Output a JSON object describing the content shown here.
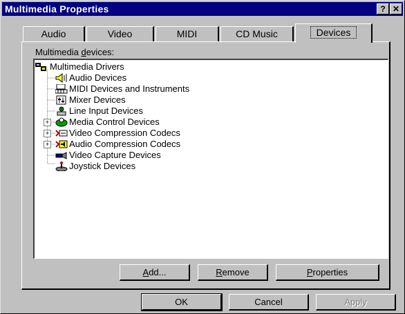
{
  "window": {
    "title": "Multimedia Properties",
    "help_label": "?",
    "close_label": "✕"
  },
  "tabs": [
    {
      "label": "Audio",
      "active": false
    },
    {
      "label": "Video",
      "active": false
    },
    {
      "label": "MIDI",
      "active": false
    },
    {
      "label": "CD Music",
      "active": false
    },
    {
      "label": "Devices",
      "active": true
    }
  ],
  "devices_panel": {
    "group_label_pre": "Multimedia ",
    "group_label_accel": "d",
    "group_label_post": "evices:",
    "tree": {
      "root": {
        "label": "Multimedia Drivers",
        "icon": "multimedia-drivers-icon"
      },
      "items": [
        {
          "label": "Audio Devices",
          "icon": "speaker-icon",
          "expandable": false
        },
        {
          "label": "MIDI Devices and Instruments",
          "icon": "midi-keyboard-icon",
          "expandable": false
        },
        {
          "label": "Mixer Devices",
          "icon": "mixer-icon",
          "expandable": false
        },
        {
          "label": "Line Input Devices",
          "icon": "line-input-icon",
          "expandable": false
        },
        {
          "label": "Media Control Devices",
          "icon": "media-control-icon",
          "expandable": true
        },
        {
          "label": "Video Compression Codecs",
          "icon": "video-codec-icon",
          "expandable": true
        },
        {
          "label": "Audio Compression Codecs",
          "icon": "audio-codec-icon",
          "expandable": true
        },
        {
          "label": "Video Capture Devices",
          "icon": "video-capture-icon",
          "expandable": false
        },
        {
          "label": "Joystick Devices",
          "icon": "joystick-icon",
          "expandable": false
        }
      ]
    },
    "buttons": {
      "add": {
        "pre": "",
        "accel": "A",
        "post": "dd..."
      },
      "remove": {
        "pre": "",
        "accel": "R",
        "post": "emove"
      },
      "properties": {
        "pre": "",
        "accel": "P",
        "post": "roperties"
      }
    }
  },
  "footer": {
    "ok_label": "OK",
    "cancel_label": "Cancel",
    "apply_label": "Apply",
    "apply_enabled": false
  },
  "colors": {
    "dialog_face": "#c0c0c0",
    "titlebar": "#000080",
    "tree_background": "#ffffff"
  }
}
